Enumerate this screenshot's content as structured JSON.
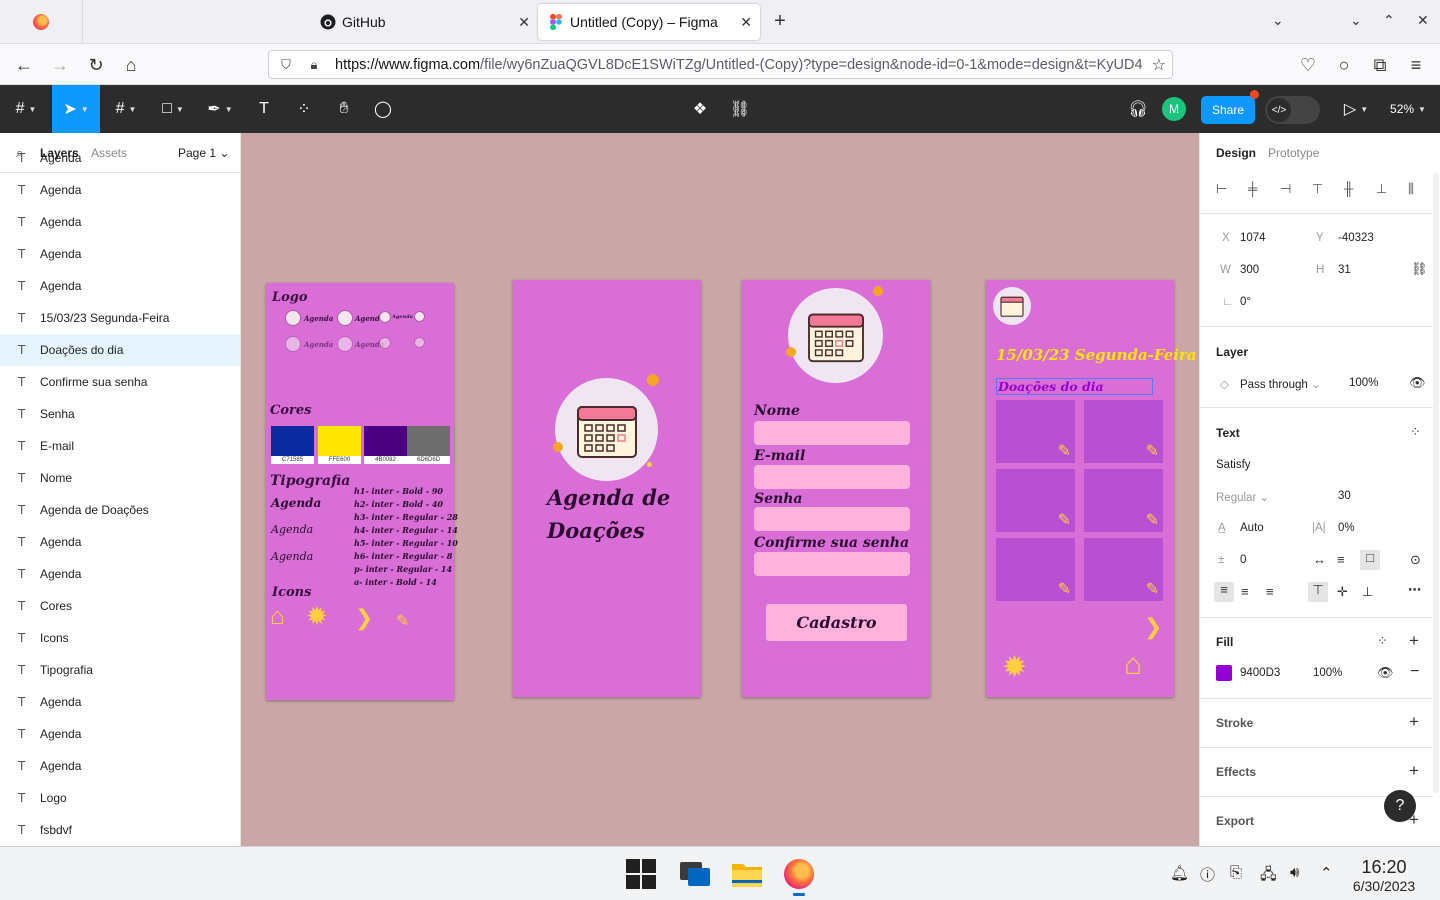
{
  "browser": {
    "tabs": [
      {
        "title": "GitHub",
        "icon": "github-icon"
      },
      {
        "title": "Untitled (Copy) – Figma",
        "icon": "figma-icon"
      }
    ],
    "url_host": "https://www.figma.com",
    "url_path": "/file/wy6nZuaQGVL8DcE1SWiTZg/Untitled-(Copy)?type=design&node-id=0-1&mode=design&t=KyUD4"
  },
  "figma": {
    "avatar_initial": "M",
    "share_label": "Share",
    "zoom": "52%"
  },
  "left_panel": {
    "tab_layers": "Layers",
    "tab_assets": "Assets",
    "page": "Page 1",
    "layers": [
      "Agenda",
      "Agenda",
      "Agenda",
      "Agenda",
      "Agenda",
      "15/03/23 Segunda-Feira",
      "Doações do dia",
      "Confirme sua senha",
      "Senha",
      "E-mail",
      "Nome",
      "Agenda de Doações",
      "Agenda",
      "Agenda",
      "Cores",
      "Icons",
      "Tipografia",
      "Agenda",
      "Agenda",
      "Agenda",
      "Logo",
      "fsbdvf"
    ],
    "selected_layer": "Doações do dia"
  },
  "canvas": {
    "style_guide": {
      "logo_label": "Logo",
      "logo_word": "Agenda",
      "colors_label": "Cores",
      "swatches": [
        {
          "hex": "C71585",
          "color": "#0a2aa0"
        },
        {
          "hex": "FFE600",
          "color": "#ffe600"
        },
        {
          "hex": "4B0082",
          "color": "#4b0082"
        },
        {
          "hex": "6D6D6D",
          "color": "#6d6d6d"
        }
      ],
      "typography_label": "Tipografia",
      "agenda_samples": [
        "Agenda",
        "Agenda",
        "Agenda"
      ],
      "type_scale": [
        "h1- inter - Bold - 90",
        "h2- inter - Bold - 40",
        "h3- inter - Regular - 28",
        "h4- inter - Regular - 14",
        "h5- inter - Regular - 10",
        "h6- inter - Regular - 8",
        "p- inter - Regular - 14",
        "a- inter - Bold - 14"
      ],
      "icons_label": "Icons"
    },
    "splash": {
      "title_line1": "Agenda de",
      "title_line2": "Doações"
    },
    "signup": {
      "labels": [
        "Nome",
        "E-mail",
        "Senha",
        "Confirme sua senha"
      ],
      "button": "Cadastro"
    },
    "daily": {
      "date": "15/03/23 Segunda-Feira",
      "selected_text": "Doações do dia"
    }
  },
  "right_panel": {
    "tab_design": "Design",
    "tab_prototype": "Prototype",
    "x_label": "X",
    "x": "1074",
    "y_label": "Y",
    "y": "-40323",
    "w_label": "W",
    "w": "300",
    "h_label": "H",
    "h": "31",
    "rotation": "0°",
    "layer_title": "Layer",
    "blend": "Pass through",
    "opacity": "100%",
    "text_title": "Text",
    "font": "Satisfy",
    "weight": "Regular",
    "size": "30",
    "line_height": "Auto",
    "letter_spacing": "0%",
    "paragraph_spacing": "0",
    "fill_title": "Fill",
    "fill_hex": "9400D3",
    "fill_opacity": "100%",
    "fill_color": "#9400d3",
    "stroke_title": "Stroke",
    "effects_title": "Effects",
    "export_title": "Export"
  },
  "taskbar": {
    "time": "16:20",
    "date": "6/30/2023"
  }
}
